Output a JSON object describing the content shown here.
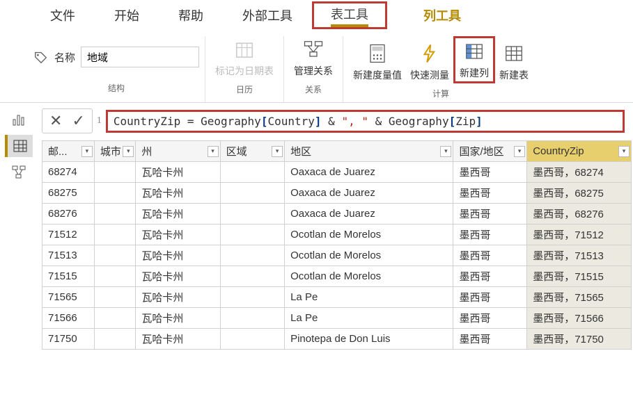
{
  "menu": {
    "file": "文件",
    "home": "开始",
    "help": "帮助",
    "ext": "外部工具",
    "table": "表工具",
    "column": "列工具"
  },
  "ribbon": {
    "name_label": "名称",
    "name_value": "地域",
    "mark_date": "标记为日期表",
    "manage_rel": "管理关系",
    "new_measure": "新建度量值",
    "quick_measure": "快速测量",
    "new_column": "新建列",
    "new_table": "新建表",
    "g_struct": "结构",
    "g_cal": "日历",
    "g_rel": "关系",
    "g_calc": "计算"
  },
  "formula": {
    "cancel": "✕",
    "confirm": "✓",
    "idx": "1",
    "p1": "CountryZip ",
    "eq": "= ",
    "p2": "Geography",
    "br_o": "[",
    "p3": "Country",
    "br_c": "]",
    "amp": " & ",
    "s1": "\", \"",
    "amp2": " & ",
    "p4": "Geography",
    "br_o2": "[",
    "p5": "Zip",
    "br_c2": "]"
  },
  "table": {
    "headers": [
      "邮...",
      "城市",
      "州",
      "区域",
      "地区",
      "国家/地区",
      "CountryZip"
    ],
    "rows": [
      [
        "68274",
        "",
        "瓦哈卡州",
        "",
        "Oaxaca de Juarez",
        "墨西哥",
        "墨西哥，68274"
      ],
      [
        "68275",
        "",
        "瓦哈卡州",
        "",
        "Oaxaca de Juarez",
        "墨西哥",
        "墨西哥，68275"
      ],
      [
        "68276",
        "",
        "瓦哈卡州",
        "",
        "Oaxaca de Juarez",
        "墨西哥",
        "墨西哥，68276"
      ],
      [
        "71512",
        "",
        "瓦哈卡州",
        "",
        "Ocotlan de Morelos",
        "墨西哥",
        "墨西哥，71512"
      ],
      [
        "71513",
        "",
        "瓦哈卡州",
        "",
        "Ocotlan de Morelos",
        "墨西哥",
        "墨西哥，71513"
      ],
      [
        "71515",
        "",
        "瓦哈卡州",
        "",
        "Ocotlan de Morelos",
        "墨西哥",
        "墨西哥，71515"
      ],
      [
        "71565",
        "",
        "瓦哈卡州",
        "",
        "La Pe",
        "墨西哥",
        "墨西哥，71565"
      ],
      [
        "71566",
        "",
        "瓦哈卡州",
        "",
        "La Pe",
        "墨西哥",
        "墨西哥，71566"
      ],
      [
        "71750",
        "",
        "瓦哈卡州",
        "",
        "Pinotepa de Don Luis",
        "墨西哥",
        "墨西哥，71750"
      ]
    ]
  },
  "chart_data": {
    "type": "table",
    "columns": [
      "邮...",
      "城市",
      "州",
      "区域",
      "地区",
      "国家/地区",
      "CountryZip"
    ],
    "rows": [
      [
        "68274",
        "",
        "瓦哈卡州",
        "",
        "Oaxaca de Juarez",
        "墨西哥",
        "墨西哥，68274"
      ],
      [
        "68275",
        "",
        "瓦哈卡州",
        "",
        "Oaxaca de Juarez",
        "墨西哥",
        "墨西哥，68275"
      ],
      [
        "68276",
        "",
        "瓦哈卡州",
        "",
        "Oaxaca de Juarez",
        "墨西哥",
        "墨西哥，68276"
      ],
      [
        "71512",
        "",
        "瓦哈卡州",
        "",
        "Ocotlan de Morelos",
        "墨西哥",
        "墨西哥，71512"
      ],
      [
        "71513",
        "",
        "瓦哈卡州",
        "",
        "Ocotlan de Morelos",
        "墨西哥",
        "墨西哥，71513"
      ],
      [
        "71515",
        "",
        "瓦哈卡州",
        "",
        "Ocotlan de Morelos",
        "墨西哥",
        "墨西哥，71515"
      ],
      [
        "71565",
        "",
        "瓦哈卡州",
        "",
        "La Pe",
        "墨西哥",
        "墨西哥，71565"
      ],
      [
        "71566",
        "",
        "瓦哈卡州",
        "",
        "La Pe",
        "墨西哥",
        "墨西哥，71566"
      ],
      [
        "71750",
        "",
        "瓦哈卡州",
        "",
        "Pinotepa de Don Luis",
        "墨西哥",
        "墨西哥，71750"
      ]
    ]
  }
}
